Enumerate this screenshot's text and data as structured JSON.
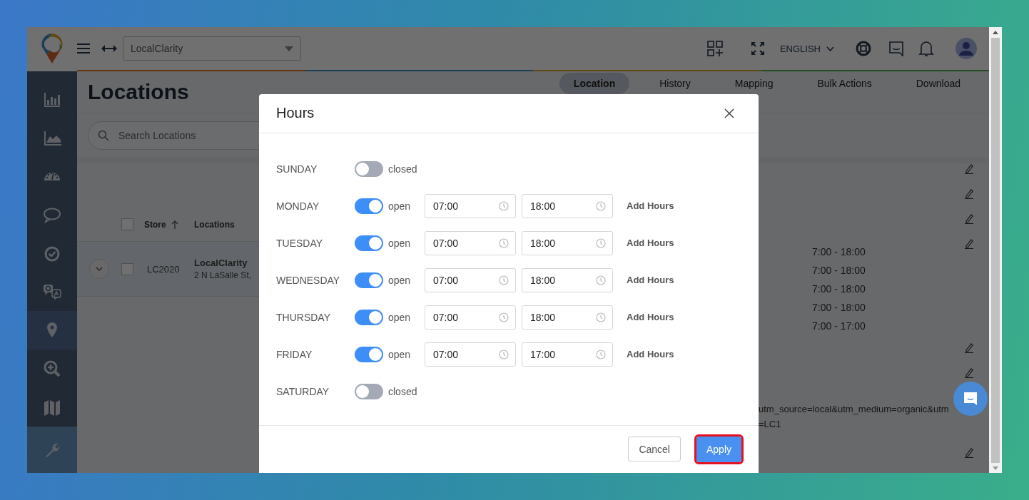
{
  "header": {
    "account_select": {
      "value": "LocalClarity"
    },
    "language": "ENGLISH"
  },
  "sidebar": {
    "items": [
      {
        "selected": false
      },
      {
        "selected": false
      },
      {
        "selected": false
      },
      {
        "selected": false
      },
      {
        "selected": false
      },
      {
        "selected": false
      },
      {
        "selected": true
      },
      {
        "selected": false
      },
      {
        "selected": false
      }
    ],
    "settings": {
      "highlighted": true
    }
  },
  "page": {
    "title": "Locations",
    "tabs": [
      {
        "label": "Location",
        "selected": true
      },
      {
        "label": "History",
        "selected": false
      },
      {
        "label": "Mapping",
        "selected": false
      },
      {
        "label": "Bulk Actions",
        "selected": false
      },
      {
        "label": "Download",
        "selected": false
      }
    ],
    "search": {
      "placeholder": "Search Locations"
    },
    "table": {
      "header_checked": false,
      "columns": [
        {
          "label": "Store",
          "sorted": true
        },
        {
          "label": "Locations",
          "sorted": false
        }
      ],
      "rows": [
        {
          "expanded": false,
          "checked": false,
          "store": "LC2020",
          "name": "LocalClarity",
          "address": "2 N LaSalle St,"
        }
      ]
    },
    "hours_lines": [
      "7:00 - 18:00",
      "7:00 - 18:00",
      "7:00 - 18:00",
      "7:00 - 18:00",
      "7:00 - 17:00"
    ],
    "url_lines": [
      "utm_source=local&utm_medium=organic&utm",
      "=LC1"
    ]
  },
  "dialog": {
    "title": "Hours",
    "days": [
      {
        "day": "SUNDAY",
        "open": false,
        "status": "closed"
      },
      {
        "day": "MONDAY",
        "open": true,
        "status": "open",
        "start": "07:00",
        "end": "18:00",
        "action": "Add Hours"
      },
      {
        "day": "TUESDAY",
        "open": true,
        "status": "open",
        "start": "07:00",
        "end": "18:00",
        "action": "Add Hours"
      },
      {
        "day": "WEDNESDAY",
        "open": true,
        "status": "open",
        "start": "07:00",
        "end": "18:00",
        "action": "Add Hours"
      },
      {
        "day": "THURSDAY",
        "open": true,
        "status": "open",
        "start": "07:00",
        "end": "18:00",
        "action": "Add Hours"
      },
      {
        "day": "FRIDAY",
        "open": true,
        "status": "open",
        "start": "07:00",
        "end": "17:00",
        "action": "Add Hours"
      },
      {
        "day": "SATURDAY",
        "open": false,
        "status": "closed"
      }
    ],
    "buttons": [
      {
        "label": "Cancel",
        "kind": "secondary",
        "highlighted": false
      },
      {
        "label": "Apply",
        "kind": "primary",
        "highlighted": true
      }
    ]
  }
}
